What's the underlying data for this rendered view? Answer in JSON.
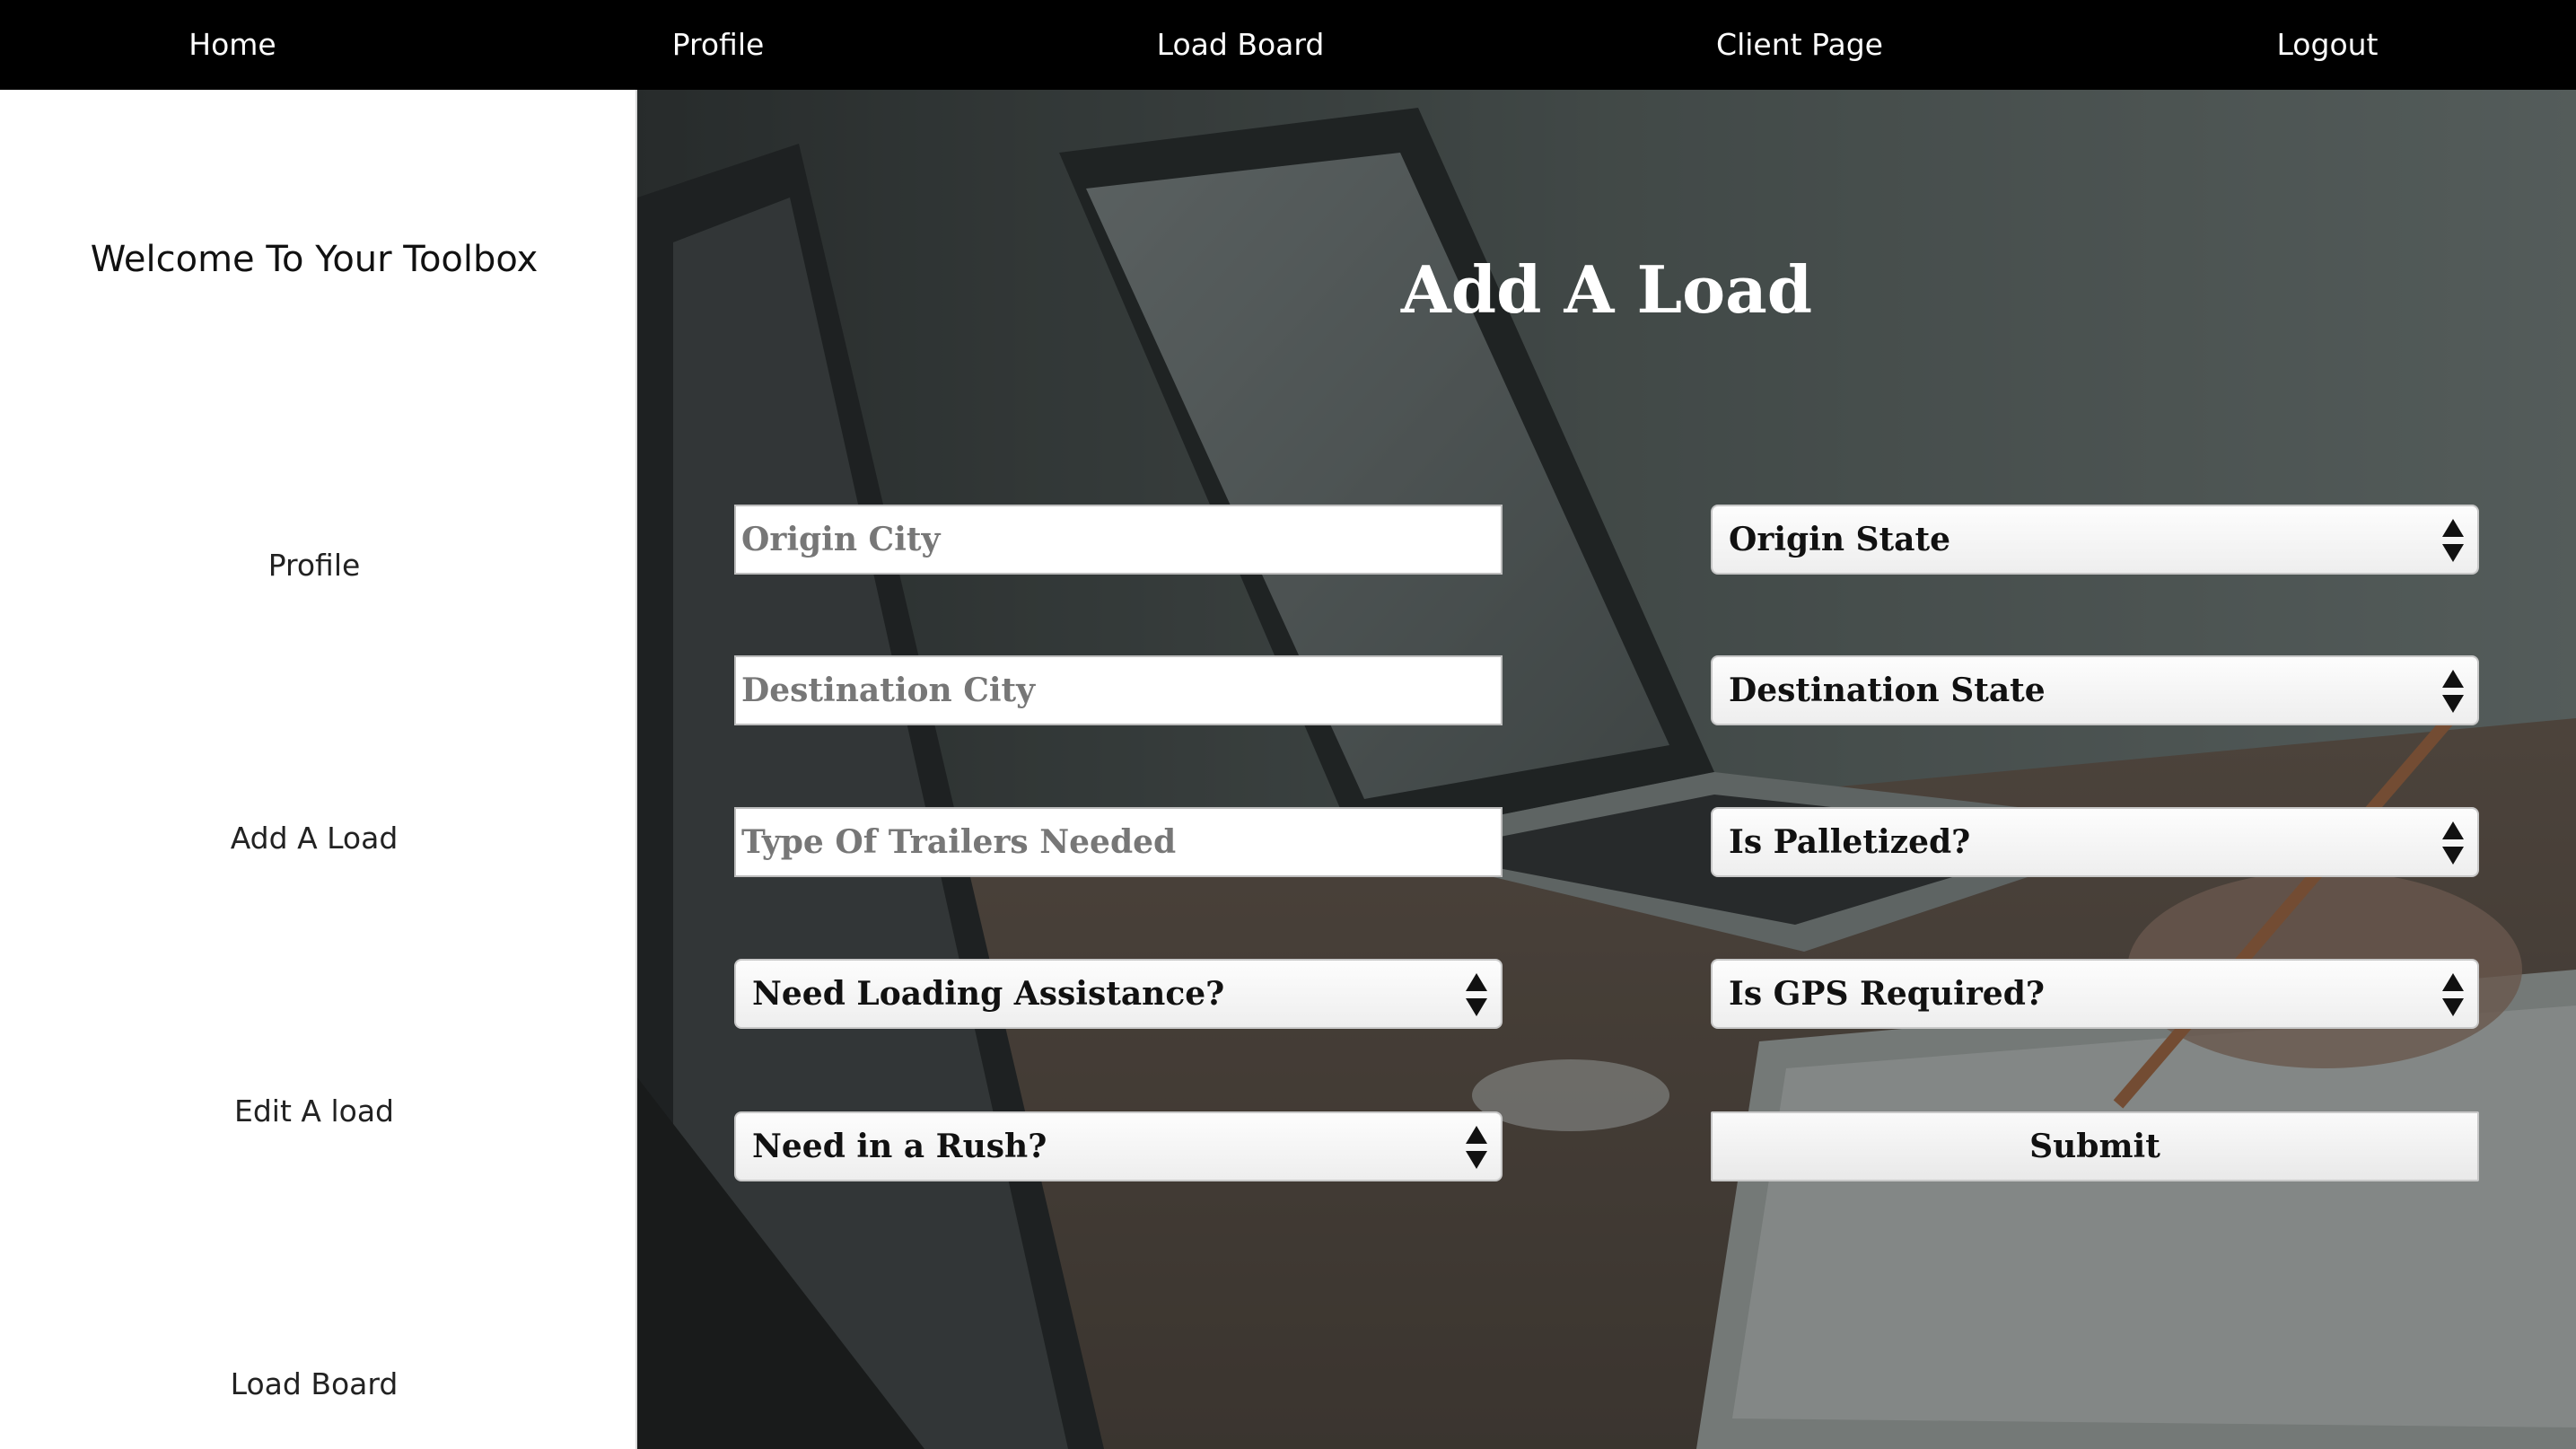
{
  "nav": {
    "home": "Home",
    "profile": "Profile",
    "load_board": "Load Board",
    "client_page": "Client Page",
    "logout": "Logout"
  },
  "sidebar": {
    "welcome": "Welcome To Your Toolbox",
    "items": [
      "Profile",
      "Add A Load",
      "Edit A load",
      "Load Board"
    ]
  },
  "main": {
    "title": "Add A Load"
  },
  "form": {
    "origin_city": {
      "placeholder": "Origin City",
      "value": ""
    },
    "destination_city": {
      "placeholder": "Destination City",
      "value": ""
    },
    "trailer_type": {
      "placeholder": "Type Of Trailers Needed",
      "value": ""
    },
    "origin_state": {
      "selected": "Origin State"
    },
    "destination_state": {
      "selected": "Destination State"
    },
    "palletized": {
      "selected": "Is Palletized?"
    },
    "loading_assistance": {
      "selected": "Need Loading Assistance?"
    },
    "gps_required": {
      "selected": "Is GPS Required?"
    },
    "rush": {
      "selected": "Need in a Rush?"
    },
    "submit_label": "Submit"
  },
  "colors": {
    "nav_bg": "#000000",
    "nav_text": "#ffffff",
    "sidebar_bg": "#ffffff",
    "title_text": "#ffffff"
  }
}
